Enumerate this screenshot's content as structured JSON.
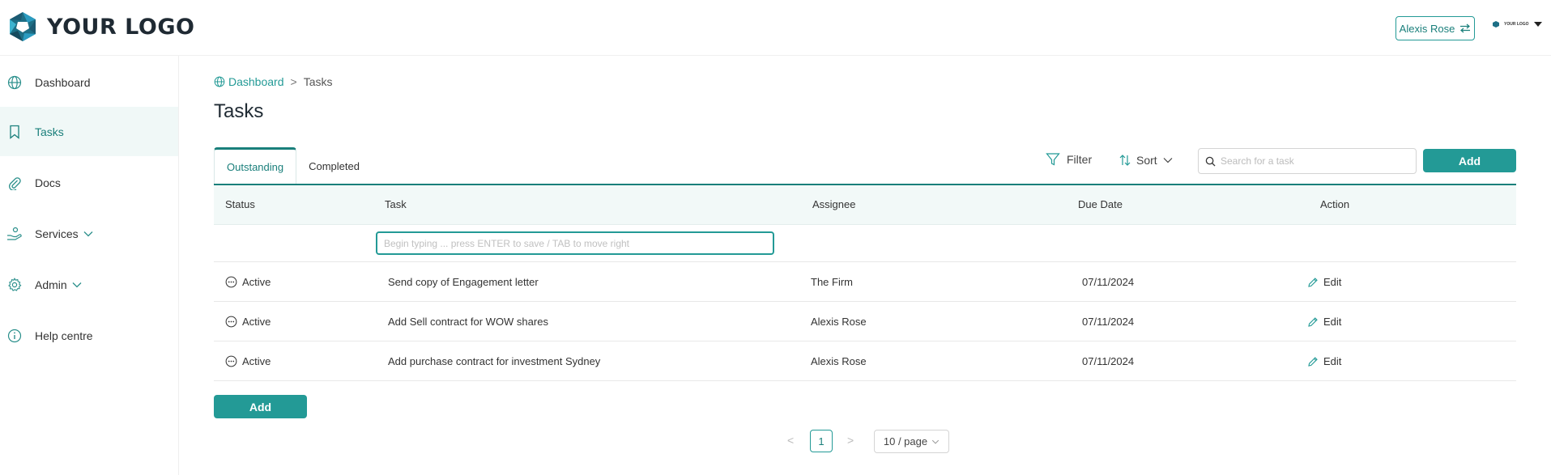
{
  "header": {
    "logo_text": "YOUR LOGO",
    "user_button_label": "Alexis Rose",
    "mini_logo_text": "YOUR LOGO"
  },
  "sidebar": {
    "items": [
      {
        "label": "Dashboard",
        "icon": "globe-icon"
      },
      {
        "label": "Tasks",
        "icon": "bookmark-icon",
        "active": true
      },
      {
        "label": "Docs",
        "icon": "paperclip-icon"
      },
      {
        "label": "Services",
        "icon": "hand-coins-icon",
        "has_submenu": true
      },
      {
        "label": "Admin",
        "icon": "gear-icon",
        "has_submenu": true
      },
      {
        "label": "Help centre",
        "icon": "info-icon"
      }
    ]
  },
  "breadcrumb": {
    "root": "Dashboard",
    "separator": ">",
    "current": "Tasks"
  },
  "page_title": "Tasks",
  "tabs": [
    {
      "label": "Outstanding",
      "active": true
    },
    {
      "label": "Completed",
      "active": false
    }
  ],
  "toolbar": {
    "filter_label": "Filter",
    "sort_label": "Sort",
    "search_placeholder": "Search for a task",
    "add_label": "Add"
  },
  "table": {
    "columns": [
      "Status",
      "Task",
      "Assignee",
      "Due Date",
      "Action"
    ],
    "new_row_placeholder": "Begin typing ... press ENTER to save / TAB to move right",
    "rows": [
      {
        "status": "Active",
        "task": "Send copy of Engagement letter",
        "assignee": "The Firm",
        "due_date": "07/11/2024",
        "action": "Edit"
      },
      {
        "status": "Active",
        "task": "Add Sell contract for WOW shares",
        "assignee": "Alexis Rose",
        "due_date": "07/11/2024",
        "action": "Edit"
      },
      {
        "status": "Active",
        "task": "Add purchase contract for investment Sydney",
        "assignee": "Alexis Rose",
        "due_date": "07/11/2024",
        "action": "Edit"
      }
    ]
  },
  "bottom_add_label": "Add",
  "pagination": {
    "prev": "<",
    "current_page": "1",
    "next": ">",
    "page_size": "10 / page"
  },
  "colors": {
    "accent": "#239a96",
    "accent_dark": "#1a7f7b",
    "active_nav_bg": "#f0f8f7",
    "table_header_bg": "#f2f9f8"
  }
}
